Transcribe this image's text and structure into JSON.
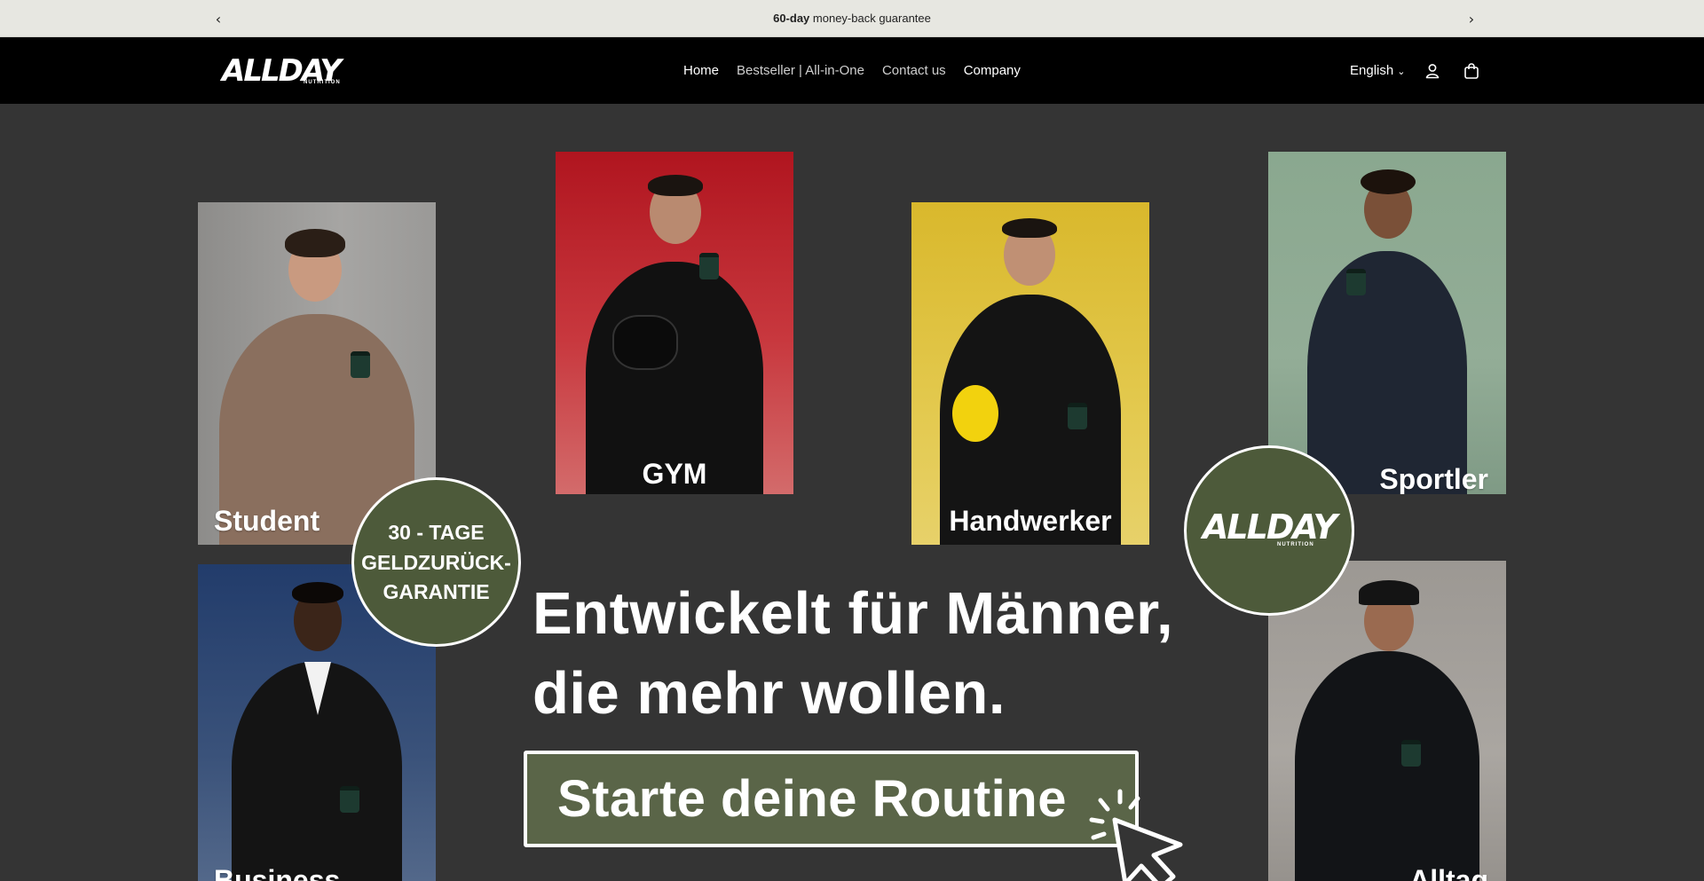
{
  "announcement": {
    "bold": "60-day",
    "text": " money-back guarantee",
    "prev_icon": "chevron-left-icon",
    "next_icon": "chevron-right-icon"
  },
  "header": {
    "logo_text": "ALLDAY",
    "logo_sub": "NUTRITION",
    "menu": [
      {
        "label": "Home"
      },
      {
        "label": "Bestseller | All-in-One"
      },
      {
        "label": "Contact us"
      },
      {
        "label": "Company"
      }
    ],
    "language": "English",
    "account_icon": "user-icon",
    "cart_icon": "shopping-bag-icon"
  },
  "hero": {
    "cards": [
      {
        "label": "Student"
      },
      {
        "label": "GYM"
      },
      {
        "label": "Handwerker"
      },
      {
        "label": "Sportler"
      },
      {
        "label": "Business"
      },
      {
        "label": "Alltag"
      }
    ],
    "guarantee_badge": [
      "30 - TAGE",
      "GELDZURÜCK-",
      "GARANTIE"
    ],
    "logo_badge": {
      "text": "ALLDAY",
      "sub": "NUTRITION"
    },
    "headline_line1": "Entwickelt für Männer,",
    "headline_line2": "die mehr wollen.",
    "cta_label": "Starte deine Routine"
  },
  "colors": {
    "background": "#343434",
    "accent_green": "#5a6548",
    "announcement_bg": "#e7e7e1"
  }
}
